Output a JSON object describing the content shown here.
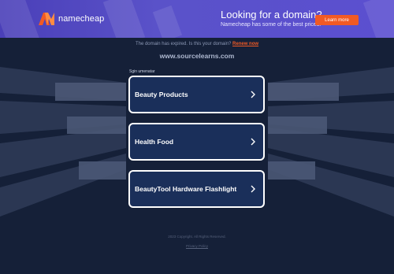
{
  "banner": {
    "logo_text": "namecheap",
    "promo_title": "Looking for a domain?",
    "promo_subtitle": "Namecheap has some of the best prices.",
    "cta_label": "Learn more",
    "colors": {
      "accent": "#f15a24",
      "background": "#5a52c9"
    }
  },
  "notice": {
    "text": "The domain has expired. Is this your domain?",
    "renew_label": "Renew now"
  },
  "domain_name": "www.sourcelearns.com",
  "related": {
    "heading": "Sgin umenatar",
    "links": [
      {
        "label": "Beauty Products"
      },
      {
        "label": "Health Food"
      },
      {
        "label": "BeautyTool Hardware Flashlight"
      }
    ]
  },
  "footer": {
    "copyright": "2023 Copyright. All Rights Reserved.",
    "privacy": "Privacy Policy"
  },
  "icons": [
    "namecheap-logo-icon",
    "chevron-right-icon"
  ]
}
